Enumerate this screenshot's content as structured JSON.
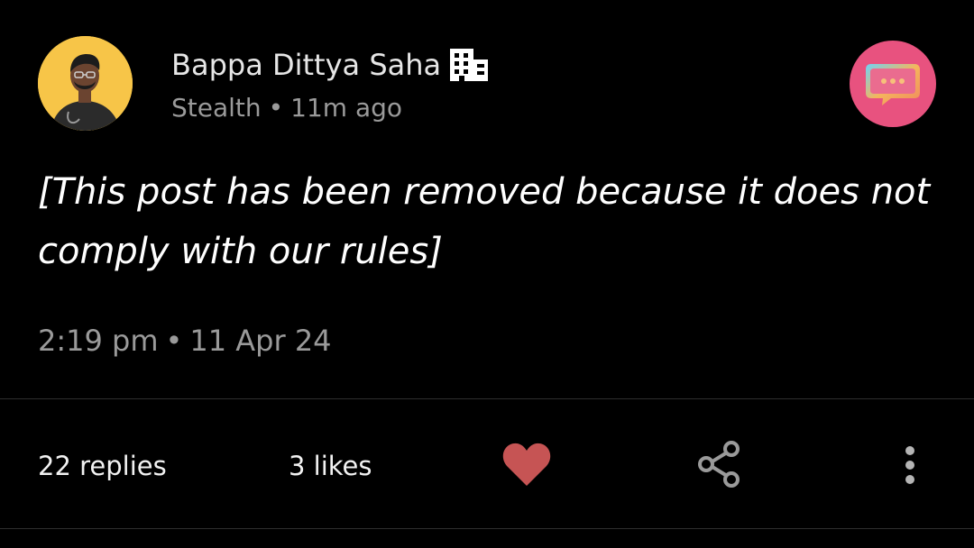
{
  "post": {
    "author": {
      "name": "Bappa Dittya Saha",
      "avatar_icon": "user-avatar",
      "org_icon": "building-icon"
    },
    "meta": {
      "company": "Stealth",
      "separator": "•",
      "relative_time": "11m ago"
    },
    "body": "[This post has been removed because it does not comply with our rules]",
    "timestamp": {
      "time": "2:19 pm",
      "separator": "•",
      "date": "11 Apr 24"
    }
  },
  "actions": {
    "replies": "22 replies",
    "likes": "3 likes",
    "like_icon": "heart-icon",
    "share_icon": "share-icon",
    "more_icon": "more-vertical-icon",
    "chat_icon": "chat-bubble-icon"
  },
  "colors": {
    "background": "#000000",
    "text_primary": "#ffffff",
    "text_secondary": "#9a9a9a",
    "heart": "#c65454",
    "chat_badge": "#e8527f"
  }
}
